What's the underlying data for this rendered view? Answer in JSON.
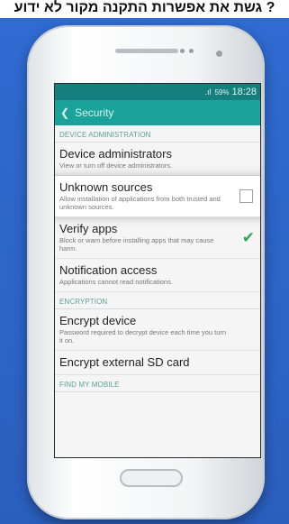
{
  "caption": "? גשת את אפשרות התקנה מקור לא ידוע",
  "status_bar": {
    "signal_text": ".ıl",
    "battery_text": "59%",
    "time": "18:28"
  },
  "action_bar": {
    "title": "Security"
  },
  "sections": [
    {
      "header": "DEVICE ADMINISTRATION",
      "items": [
        {
          "title": "Device administrators",
          "desc": "View or turn off device administrators."
        },
        {
          "title": "Unknown sources",
          "desc": "Allow installation of applications from both trusted and unknown sources.",
          "checked": false
        },
        {
          "title": "Verify apps",
          "desc": "Block or warn before installing apps that may cause harm.",
          "checked": true
        },
        {
          "title": "Notification access",
          "desc": "Applications cannot read notifications."
        }
      ]
    },
    {
      "header": "ENCRYPTION",
      "items": [
        {
          "title": "Encrypt device",
          "desc": "Password required to decrypt device each time you turn it on."
        },
        {
          "title": "Encrypt external SD card"
        }
      ]
    },
    {
      "header": "FIND MY MOBILE",
      "items": []
    }
  ],
  "icons": {
    "back": "chevron-left-icon",
    "check": "checkmark-icon",
    "battery": "battery-icon",
    "signal": "signal-icon"
  },
  "colors": {
    "status_bar": "#147f7c",
    "action_bar": "#1aa39b",
    "backdrop": "#2f6bd1",
    "check": "#2fa84f"
  }
}
